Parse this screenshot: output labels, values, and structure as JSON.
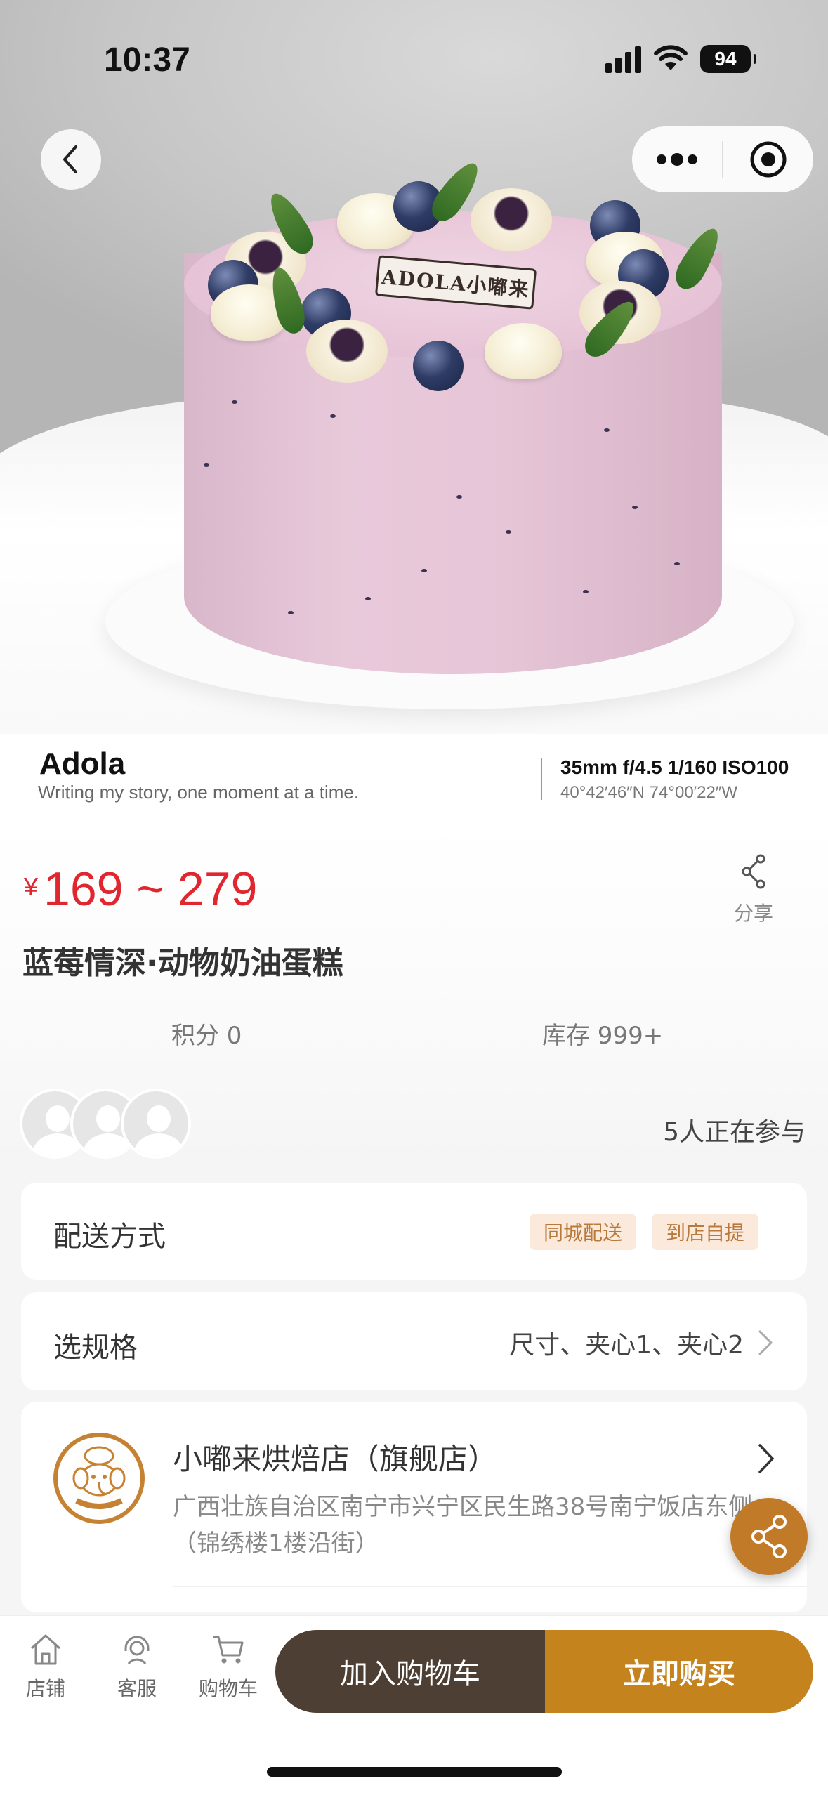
{
  "status_bar": {
    "time": "10:37",
    "battery": "94",
    "icons": [
      "cellular-signal-icon",
      "wifi-icon",
      "battery-icon"
    ]
  },
  "hero": {
    "plaque_text": "ADOLA小嘟来",
    "icons": [
      "back-chevron-icon",
      "more-dots-icon",
      "close-target-icon"
    ]
  },
  "watermark": {
    "brand": "Adola",
    "tagline": "Writing my story, one moment at a time.",
    "camera": "35mm f/4.5 1/160 ISO100",
    "coords": "40°42′46″N 74°00′22″W"
  },
  "product": {
    "currency": "¥",
    "price_range": "169 ~ 279",
    "share_label": "分享",
    "title": "蓝莓情深·动物奶油蛋糕",
    "points": "积分 0",
    "stock": "库存 999+",
    "participants": "5人正在参与"
  },
  "delivery": {
    "label": "配送方式",
    "tags": [
      "同城配送",
      "到店自提"
    ]
  },
  "spec": {
    "label": "选规格",
    "value": "尺寸、夹心1、夹心2"
  },
  "shop": {
    "name": "小嘟来烘焙店（旗舰店）",
    "address_line1": "广西壮族自治区南宁市兴宁区民生路38号南宁饭店东侧",
    "address_line2": "（锦绣楼1楼沿街）",
    "logo_text": "ADOLA小嘟来"
  },
  "bottom_nav": {
    "items": [
      {
        "label": "店铺",
        "icon": "store-icon"
      },
      {
        "label": "客服",
        "icon": "customer-service-icon"
      },
      {
        "label": "购物车",
        "icon": "cart-icon"
      }
    ],
    "add_to_cart": "加入购物车",
    "buy_now": "立即购买"
  },
  "colors": {
    "price": "#e0262f",
    "cart_button": "#4e3f34",
    "buy_button": "#c4831d",
    "share_fab": "#c17a28",
    "tag_bg": "#fbeadb",
    "tag_text": "#b8793c"
  }
}
